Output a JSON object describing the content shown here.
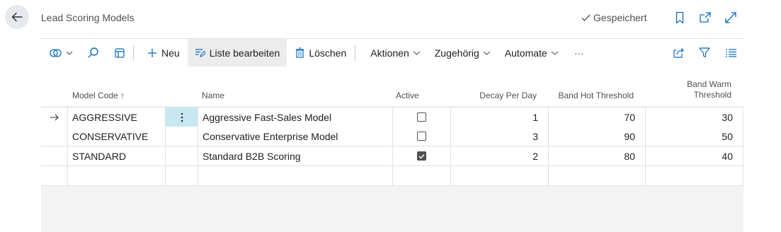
{
  "header": {
    "title": "Lead Scoring Models",
    "saved_label": "Gespeichert"
  },
  "toolbar": {
    "new_label": "Neu",
    "edit_list_label": "Liste bearbeiten",
    "delete_label": "Löschen",
    "actions_label": "Aktionen",
    "related_label": "Zugehörig",
    "automate_label": "Automate",
    "more_label": "···"
  },
  "columns": {
    "model_code": "Model Code",
    "model_code_sort": "↑",
    "name": "Name",
    "active": "Active",
    "decay_per_day": "Decay Per Day",
    "band_hot_threshold": "Band Hot Threshold",
    "band_warm_threshold_line1": "Band Warm",
    "band_warm_threshold_line2": "Threshold"
  },
  "rows": [
    {
      "model_code": "AGGRESSIVE",
      "name": "Aggressive Fast-Sales Model",
      "active": false,
      "decay_per_day": "1",
      "band_hot_threshold": "70",
      "band_warm_threshold": "30"
    },
    {
      "model_code": "CONSERVATIVE",
      "name": "Conservative Enterprise Model",
      "active": false,
      "decay_per_day": "3",
      "band_hot_threshold": "90",
      "band_warm_threshold": "50"
    },
    {
      "model_code": "STANDARD",
      "name": "Standard B2B Scoring",
      "active": true,
      "decay_per_day": "2",
      "band_hot_threshold": "80",
      "band_warm_threshold": "40"
    }
  ],
  "colors": {
    "accent": "#0f6cbd",
    "selected_cell": "#c7e8f3",
    "hover_button": "#ececec"
  },
  "icons": {
    "back": "arrow-left-icon",
    "saved": "check-icon",
    "bookmark": "bookmark-icon",
    "open_new": "open-new-window-icon",
    "expand": "expand-icon",
    "analysis": "filter-analysis-icon",
    "search": "search-icon",
    "view": "view-layout-icon",
    "new": "plus-icon",
    "edit_list": "edit-list-icon",
    "delete": "trash-icon",
    "share": "share-icon",
    "filter": "filter-icon",
    "list_view": "list-view-icon"
  }
}
